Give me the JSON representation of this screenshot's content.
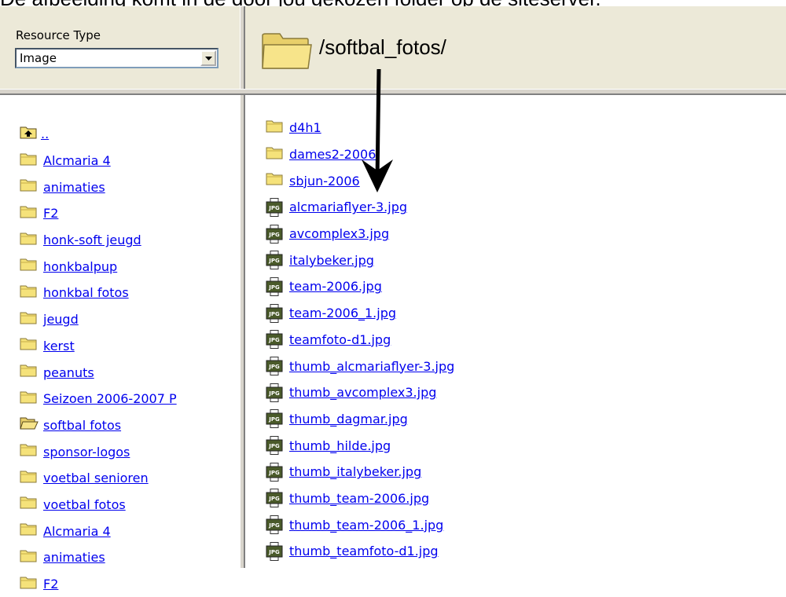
{
  "caption": "De afbeelding komt in de door jou gekozen folder op de siteserver.",
  "resource_type": {
    "label": "Resource Type",
    "value": "Image"
  },
  "current_path": "/softbal_fotos/",
  "left_list": [
    {
      "label": "..",
      "icon": "folder-up-icon"
    },
    {
      "label": "Alcmaria 4",
      "icon": "folder-icon"
    },
    {
      "label": "animaties",
      "icon": "folder-icon"
    },
    {
      "label": "F2",
      "icon": "folder-icon"
    },
    {
      "label": "honk-soft jeugd",
      "icon": "folder-icon"
    },
    {
      "label": "honkbalpup",
      "icon": "folder-icon"
    },
    {
      "label": "honkbal fotos",
      "icon": "folder-icon"
    },
    {
      "label": "jeugd",
      "icon": "folder-icon"
    },
    {
      "label": "kerst",
      "icon": "folder-icon"
    },
    {
      "label": "peanuts",
      "icon": "folder-icon"
    },
    {
      "label": "Seizoen 2006-2007 P",
      "icon": "folder-icon"
    },
    {
      "label": "softbal fotos",
      "icon": "folder-open-icon"
    },
    {
      "label": "sponsor-logos",
      "icon": "folder-icon"
    },
    {
      "label": "voetbal senioren",
      "icon": "folder-icon"
    },
    {
      "label": "voetbal fotos",
      "icon": "folder-icon"
    },
    {
      "label": "Alcmaria 4",
      "icon": "folder-icon"
    },
    {
      "label": "animaties",
      "icon": "folder-icon"
    },
    {
      "label": "F2",
      "icon": "folder-icon"
    }
  ],
  "right_list": [
    {
      "label": "d4h1",
      "icon": "folder-icon"
    },
    {
      "label": "dames2-2006",
      "icon": "folder-icon"
    },
    {
      "label": "sbjun-2006",
      "icon": "folder-icon"
    },
    {
      "label": "alcmariaflyer-3.jpg",
      "icon": "jpg-file-icon"
    },
    {
      "label": "avcomplex3.jpg",
      "icon": "jpg-file-icon"
    },
    {
      "label": "italybeker.jpg",
      "icon": "jpg-file-icon"
    },
    {
      "label": "team-2006.jpg",
      "icon": "jpg-file-icon"
    },
    {
      "label": "team-2006_1.jpg",
      "icon": "jpg-file-icon"
    },
    {
      "label": "teamfoto-d1.jpg",
      "icon": "jpg-file-icon"
    },
    {
      "label": "thumb_alcmariaflyer-3.jpg",
      "icon": "jpg-file-icon"
    },
    {
      "label": "thumb_avcomplex3.jpg",
      "icon": "jpg-file-icon"
    },
    {
      "label": "thumb_dagmar.jpg",
      "icon": "jpg-file-icon"
    },
    {
      "label": "thumb_hilde.jpg",
      "icon": "jpg-file-icon"
    },
    {
      "label": "thumb_italybeker.jpg",
      "icon": "jpg-file-icon"
    },
    {
      "label": "thumb_team-2006.jpg",
      "icon": "jpg-file-icon"
    },
    {
      "label": "thumb_team-2006_1.jpg",
      "icon": "jpg-file-icon"
    },
    {
      "label": "thumb_teamfoto-d1.jpg",
      "icon": "jpg-file-icon"
    }
  ],
  "colors": {
    "link": "#0000ee",
    "folder": "#f5e27a",
    "folder_edge": "#8a7a3a",
    "panel": "#ece9d8"
  }
}
